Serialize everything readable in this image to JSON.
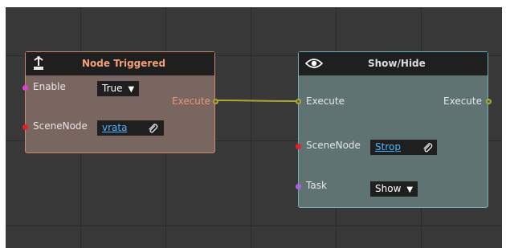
{
  "colors": {
    "canvas_bg": "#383838",
    "grid_line": "#2b2b2b",
    "node_trigger_bg": "#7a6660",
    "node_trigger_border": "#c98b6e",
    "node_show_bg": "#5f7373",
    "node_show_border": "#6fb3b6",
    "wire": "#a8a838",
    "link_text": "#4db4ff"
  },
  "nodes": {
    "trigger": {
      "icon": "trigger-lever-icon",
      "title": "Node Triggered",
      "enable_label": "Enable",
      "enable_value": "True",
      "scenenode_label": "SceneNode",
      "scenenode_value": "vrata",
      "execute_out_label": "Execute"
    },
    "show_hide": {
      "icon": "eye-icon",
      "title": "Show/Hide",
      "execute_in_label": "Execute",
      "execute_out_label": "Execute",
      "scenenode_label": "SceneNode",
      "scenenode_value": "Strop",
      "task_label": "Task",
      "task_value": "Show"
    }
  },
  "dropdown_arrow": "▼"
}
